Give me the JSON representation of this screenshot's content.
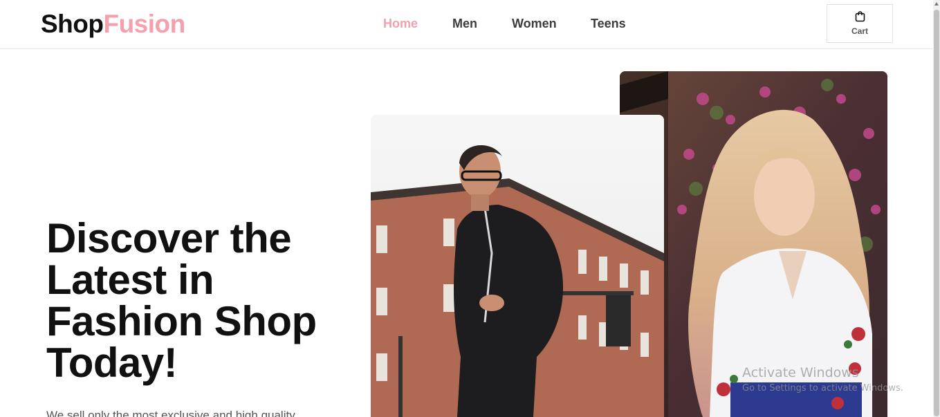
{
  "brand": {
    "part1": "Shop",
    "part2": "Fusion",
    "accent_color": "#f4a0ad"
  },
  "nav": {
    "items": [
      {
        "label": "Home",
        "active": true
      },
      {
        "label": "Men",
        "active": false
      },
      {
        "label": "Women",
        "active": false
      },
      {
        "label": "Teens",
        "active": false
      }
    ]
  },
  "cart": {
    "label": "Cart",
    "icon": "shopping-bag-icon"
  },
  "hero": {
    "title": "Discover the Latest in Fashion Shop Today!",
    "subtitle": "We sell only the most exclusive and high quality",
    "images": [
      "men-fashion-photo",
      "women-fashion-photo"
    ]
  },
  "watermark": {
    "line1": "Activate Windows",
    "line2": "Go to Settings to activate Windows."
  }
}
